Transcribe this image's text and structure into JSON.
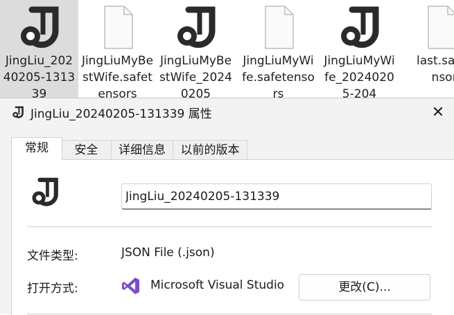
{
  "files": [
    {
      "name": "JingLiu_20240205-131339",
      "icon": "jingliu-logo-icon",
      "selected": true
    },
    {
      "name": "JingLiuMyBestWife.safetensors",
      "icon": "blank-document-icon",
      "selected": false
    },
    {
      "name": "JingLiuMyBestWife_20240205",
      "icon": "jingliu-logo-icon",
      "selected": false
    },
    {
      "name": "JingLiuMyWife.safetensors",
      "icon": "blank-document-icon",
      "selected": false
    },
    {
      "name": "JingLiuMyWife_20240205-204",
      "icon": "jingliu-logo-icon",
      "selected": false
    },
    {
      "name": "last.safetensors",
      "icon": "blank-document-icon",
      "selected": false
    }
  ],
  "dialog": {
    "title": "JingLiu_20240205-131339 属性",
    "close_glyph": "✕",
    "tabs": [
      "常规",
      "安全",
      "详细信息",
      "以前的版本"
    ],
    "active_tab": 0,
    "filename_value": "JingLiu_20240205-131339",
    "file_type_label": "文件类型:",
    "file_type_value": "JSON File (.json)",
    "open_with_label": "打开方式:",
    "open_with_app": "Microsoft Visual Studio",
    "change_button": "更改(C)..."
  },
  "colors": {
    "selected_file_bg": "#dcdcdc",
    "dialog_bg": "#f3f3f3",
    "vs_purple": "#7b4fc9"
  }
}
